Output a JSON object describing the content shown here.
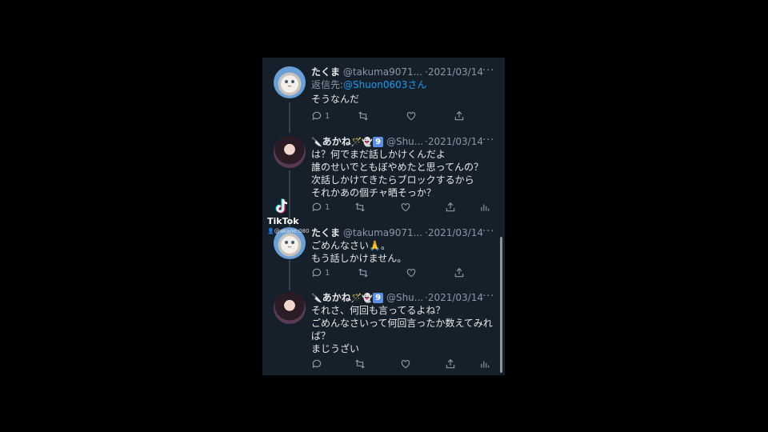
{
  "tweets": [
    {
      "name": "たくま",
      "handle": "@takuma9071...",
      "date": "·2021/03/14",
      "reply_prefix": "返信先:",
      "reply_mention": "@Shuon0603さん",
      "lines": [
        "そうなんだ"
      ],
      "reply_count": "1"
    },
    {
      "name": "あかね",
      "name_deco": "🔪あかね🪄👻",
      "badge": "9",
      "handle": "@Shu...",
      "date": "·2021/03/14",
      "lines": [
        "は？何でまだ話しかけくんだよ",
        "誰のせいでともぼやめたと思ってんの？",
        "次話しかけてきたらブロックするから",
        "それかあの個チャ晒そっか？"
      ],
      "reply_count": "1"
    },
    {
      "name": "たくま",
      "handle": "@takuma9071...",
      "date": "·2021/03/14",
      "lines": [
        "ごめんなさい🙏。",
        "もう話しかけません。"
      ],
      "reply_count": "1"
    },
    {
      "name": "あかね",
      "badge": "9",
      "handle": "@Shu...",
      "date": "·2021/03/14",
      "lines": [
        "それさ、何回も言ってるよね？",
        "ごめんなさいって何回言ったか数えてみれ",
        "ば？",
        "まじうざい"
      ],
      "reply_count": ""
    }
  ],
  "more_label": "···",
  "tiktok": {
    "label": "TikTok",
    "user": "@akane.080"
  },
  "icons": [
    "reply-icon",
    "retweet-icon",
    "like-icon",
    "share-icon",
    "analytics-icon",
    "more-icon",
    "tiktok-logo-icon"
  ],
  "colors": {
    "background": "#15202b",
    "mention": "#1d9bf0",
    "muted": "#8b98a5",
    "text": "#e7e9ea"
  }
}
